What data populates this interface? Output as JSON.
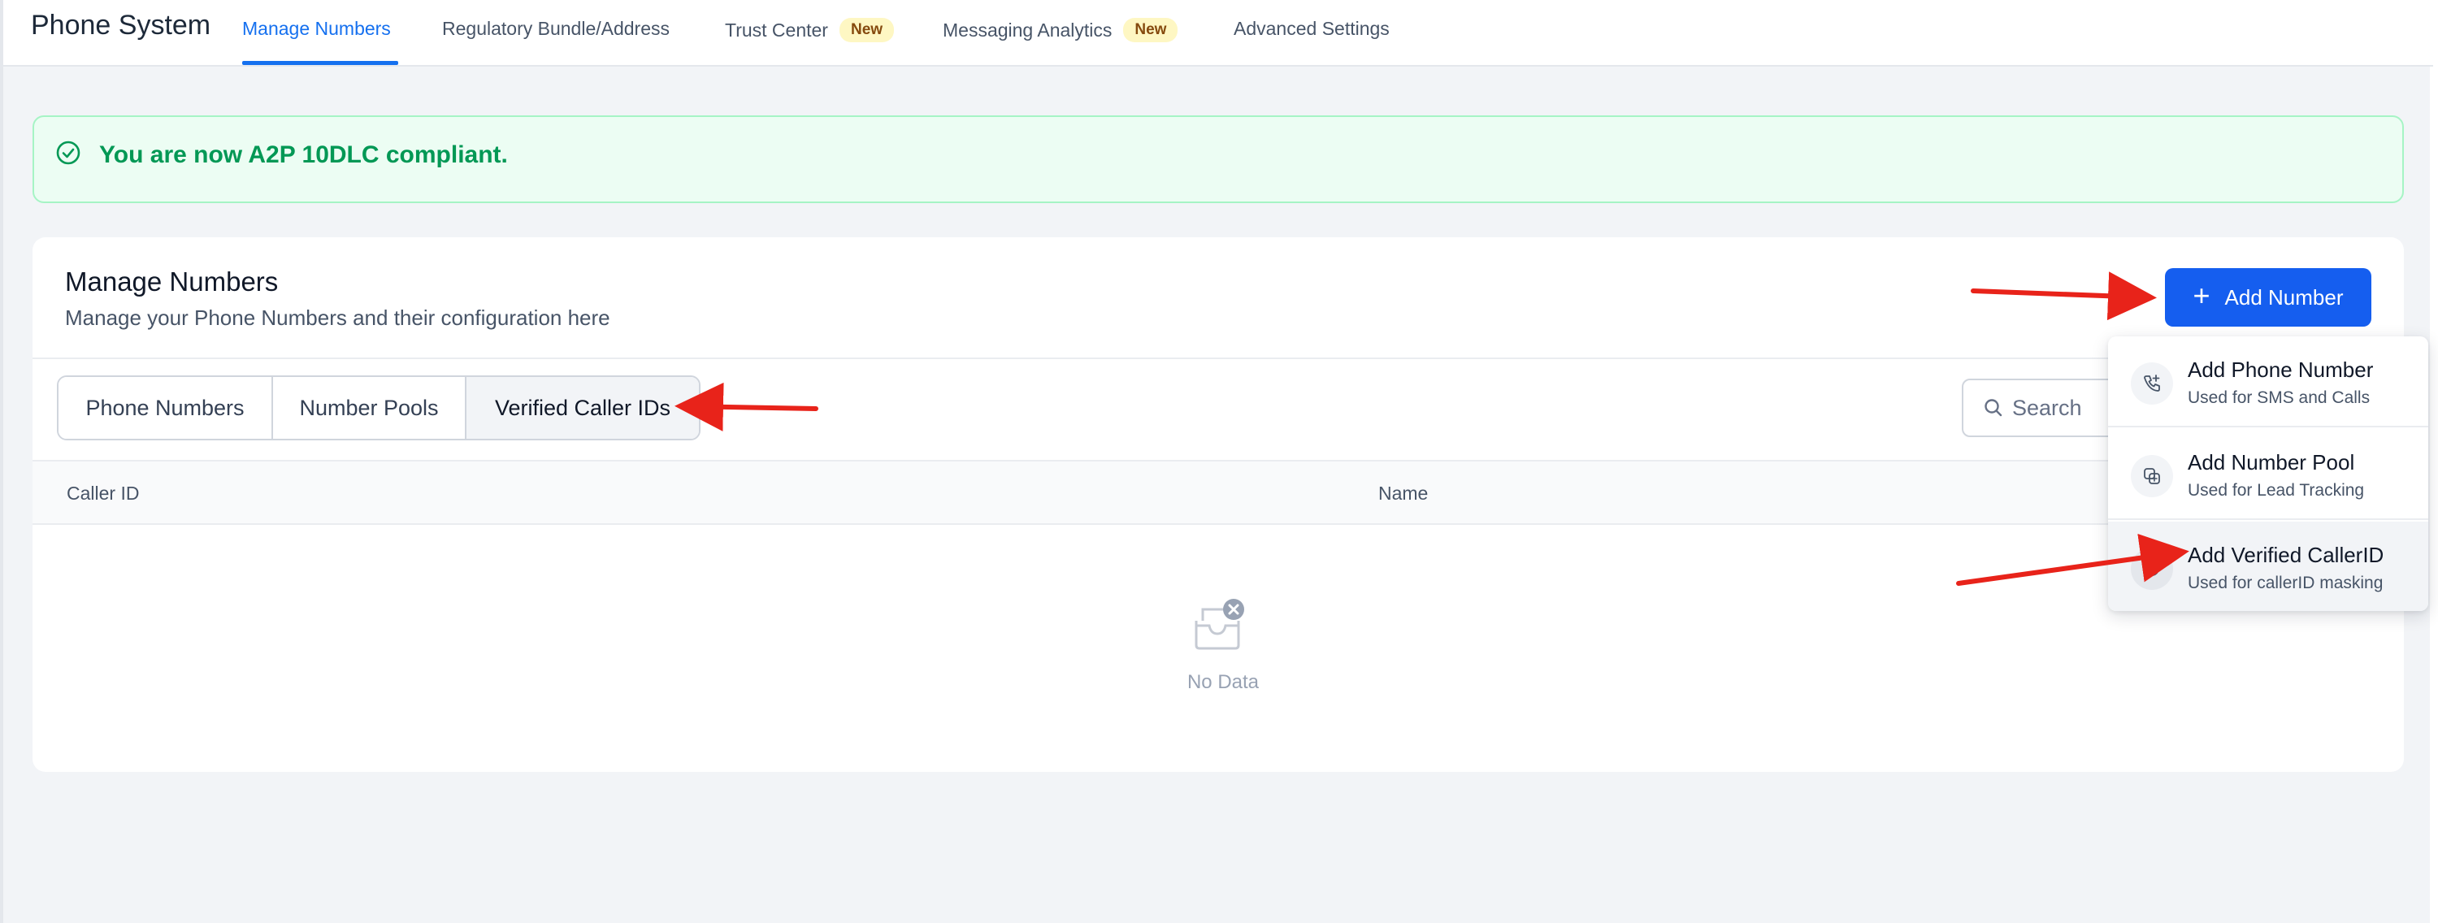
{
  "topbar": {
    "app_title": "Phone System",
    "nav": [
      {
        "label": "Manage Numbers",
        "active": true
      },
      {
        "label": "Regulatory Bundle/Address",
        "active": false
      },
      {
        "label": "Trust Center",
        "badge": "New",
        "active": false
      },
      {
        "label": "Messaging Analytics",
        "badge": "New",
        "active": false
      },
      {
        "label": "Advanced Settings",
        "active": false
      }
    ]
  },
  "alert": {
    "text": "You are now A2P 10DLC compliant.",
    "icon": "check-circle-icon"
  },
  "card": {
    "title": "Manage Numbers",
    "subtitle": "Manage your Phone Numbers and their configuration here",
    "add_button_label": "Add Number",
    "tabs": [
      {
        "label": "Phone Numbers",
        "selected": false
      },
      {
        "label": "Number Pools",
        "selected": false
      },
      {
        "label": "Verified Caller IDs",
        "selected": true
      }
    ],
    "search_placeholder": "Search",
    "table": {
      "columns": [
        "Caller ID",
        "Name"
      ],
      "empty_text": "No Data"
    }
  },
  "dropdown": {
    "items": [
      {
        "title": "Add Phone Number",
        "subtitle": "Used for SMS and Calls",
        "icon": "phone-plus-icon"
      },
      {
        "title": "Add Number Pool",
        "subtitle": "Used for Lead Tracking",
        "icon": "number-pool-icon"
      },
      {
        "title": "Add Verified CallerID",
        "subtitle": "Used for callerID masking",
        "icon": "verified-caller-icon",
        "hovered": true
      }
    ]
  },
  "colors": {
    "primary": "#155eef",
    "nav_active": "#1570ef",
    "success": "#039855",
    "success_bg": "#ecfdf3",
    "badge_bg": "#fef7c3",
    "annotation_arrow": "#e8231a"
  }
}
